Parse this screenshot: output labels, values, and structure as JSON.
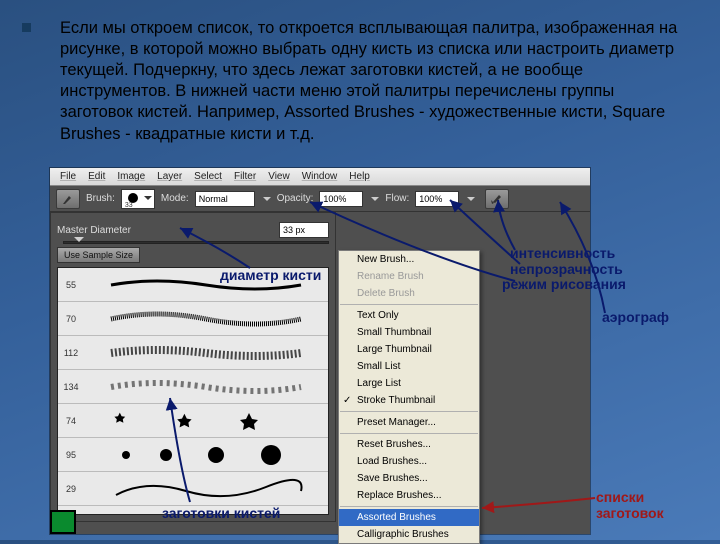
{
  "bullet_text": "Если мы откроем список, то откроется всплывающая палитра, изображенная на рисунке, в которой можно выбрать одну кисть из списка или настроить диаметр текущей. Подчеркну, что здесь лежат заготовки кистей, а не вообще инструментов. В нижней части меню этой палитры перечислены группы заготовок кистей. Например, Assorted Brushes - художественные кисти, Square Brushes - квадратные кисти и т.д.",
  "menubar": [
    "File",
    "Edit",
    "Image",
    "Layer",
    "Select",
    "Filter",
    "View",
    "Window",
    "Help"
  ],
  "optionbar": {
    "brush_label": "Brush:",
    "brush_size": "33",
    "mode_label": "Mode:",
    "mode_value": "Normal",
    "opacity_label": "Opacity:",
    "opacity_value": "100%",
    "flow_label": "Flow:",
    "flow_value": "100%"
  },
  "palette": {
    "master_label": "Master Diameter",
    "master_value": "33 px",
    "sample_btn": "Use Sample Size",
    "brush_rows": [
      {
        "size": "55"
      },
      {
        "size": "70"
      },
      {
        "size": "112"
      },
      {
        "size": "134"
      },
      {
        "size": "74"
      },
      {
        "size": "95"
      },
      {
        "size": "29"
      }
    ]
  },
  "context_menu": {
    "items": [
      {
        "t": "New Brush...",
        "type": "norm"
      },
      {
        "t": "Rename Brush",
        "type": "dim"
      },
      {
        "t": "Delete Brush",
        "type": "dim"
      },
      {
        "type": "sep"
      },
      {
        "t": "Text Only",
        "type": "norm"
      },
      {
        "t": "Small Thumbnail",
        "type": "norm"
      },
      {
        "t": "Large Thumbnail",
        "type": "norm"
      },
      {
        "t": "Small List",
        "type": "norm"
      },
      {
        "t": "Large List",
        "type": "norm"
      },
      {
        "t": "Stroke Thumbnail",
        "type": "check"
      },
      {
        "type": "sep"
      },
      {
        "t": "Preset Manager...",
        "type": "norm"
      },
      {
        "type": "sep"
      },
      {
        "t": "Reset Brushes...",
        "type": "norm"
      },
      {
        "t": "Load Brushes...",
        "type": "norm"
      },
      {
        "t": "Save Brushes...",
        "type": "norm"
      },
      {
        "t": "Replace Brushes...",
        "type": "norm"
      },
      {
        "type": "sep"
      },
      {
        "t": "Assorted Brushes",
        "type": "hl"
      },
      {
        "t": "Calligraphic Brushes",
        "type": "norm"
      }
    ]
  },
  "callouts": {
    "diameter": "диаметр кисти",
    "intensity": "интенсивность",
    "opacity": "непрозрачность",
    "mode": "режим рисования",
    "airbrush": "аэрограф",
    "presets": "заготовки кистей",
    "lists": "списки",
    "lists2": "заготовок"
  }
}
